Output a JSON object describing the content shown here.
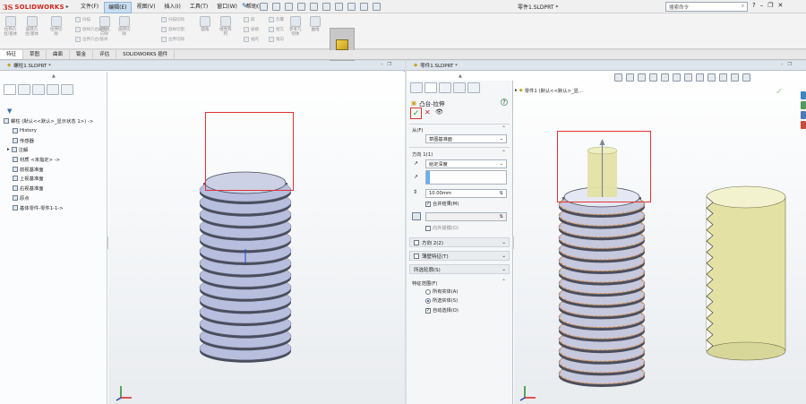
{
  "app": {
    "logo_prefix": "3S",
    "logo_name": "SOLIDWORKS"
  },
  "menu": [
    "文件(F)",
    "编辑(E)",
    "视图(V)",
    "插入(I)",
    "工具(T)",
    "窗口(W)",
    "帮助(H)"
  ],
  "active_menu": 1,
  "window_title": "零件1.SLDPRT *",
  "search": {
    "placeholder": "搜索命令"
  },
  "ribbon": {
    "groups": [
      {
        "label": "拉伸凸\n台/基体"
      },
      {
        "label": "旋转凸\n台/基体"
      },
      {
        "label": "拉伸切\n除"
      },
      {
        "label": "异型孔\n向导"
      },
      {
        "label": "旋转切\n除"
      },
      {
        "label": "圆角"
      },
      {
        "label": "线性阵\n列"
      },
      {
        "label": "参考几\n何体"
      },
      {
        "label": "曲线"
      }
    ],
    "small": [
      "扫描",
      "放样凸台/基体",
      "边界凸台/基体",
      "扫描切除",
      "放样切割",
      "边界切除",
      "筋",
      "拔模",
      "抽壳",
      "包覆",
      "相交",
      "镜向"
    ],
    "instant3d": "Instant3D"
  },
  "command_tabs": [
    "特征",
    "草图",
    "曲面",
    "钣金",
    "评估",
    "SOLIDWORKS 插件"
  ],
  "active_tab": 0,
  "left_doc": {
    "title": "螺柱1.SLDPRT *",
    "tree": [
      "螺柱 (默认<<默认>_显示状态 1>) ->",
      "History",
      "传感器",
      "注解",
      "材质 <未指定> ->",
      "前视基准面",
      "上视基准面",
      "右视基准面",
      "原点",
      "基体零件-零件1-1->"
    ]
  },
  "right_doc": {
    "title": "零件1.SLDPRT *",
    "breadcrumb": "零件1 (默认<<默认>_显...",
    "property_manager": {
      "title": "凸台-拉伸",
      "help": "?",
      "from_label": "从(F)",
      "from_value": "草图基准面",
      "direction1_label": "方向 1(1)",
      "end_condition": "给定深度",
      "depth": "10.00mm",
      "merge": "合并结果(M)",
      "draft_outward": "向外拔模(O)",
      "direction2_label": "方向 2(2)",
      "thin_feature": "薄壁特征(T)",
      "selected_contours": "所选轮廓(S)",
      "feature_scope": "特征范围(F)",
      "all_bodies": "所有实体(A)",
      "selected_bodies": "所选实体(S)",
      "auto_select": "自动选择(O)"
    }
  },
  "colors": {
    "accent": "#d2261d",
    "highlight_red": "#e03434",
    "thread_fill": "#b8bede",
    "cylinder": "#e3e2a4"
  }
}
